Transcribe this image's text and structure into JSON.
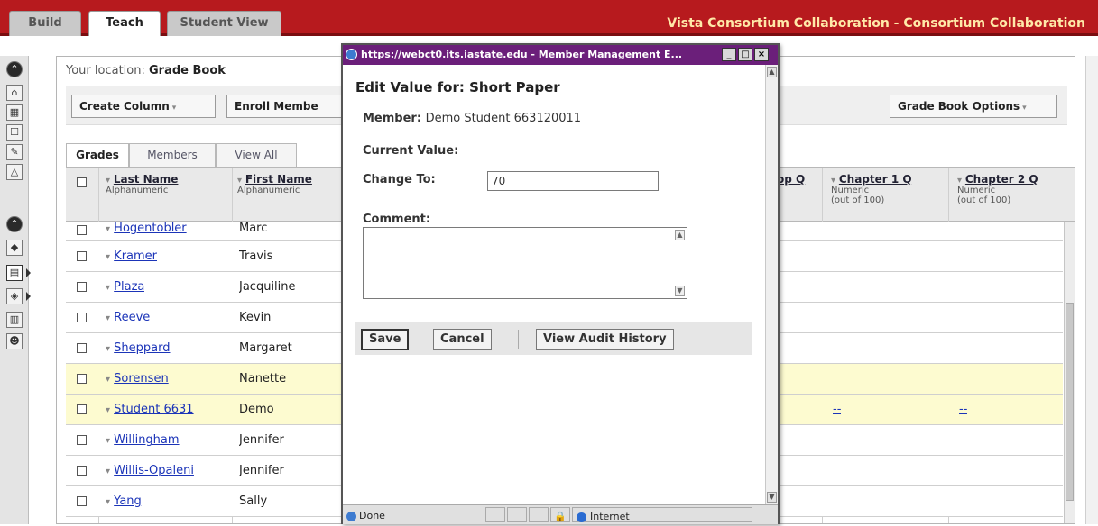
{
  "topbar": {
    "tabs": [
      {
        "label": "Build"
      },
      {
        "label": "Teach"
      },
      {
        "label": "Student View"
      }
    ],
    "org_title": "Vista Consortium Collaboration - Consortium Collaboration"
  },
  "location": {
    "prefix": "Your location:",
    "page": "Grade Book"
  },
  "toolbar": {
    "create_column": "Create Column",
    "enroll_members": "Enroll Membe",
    "grade_book_options": "Grade Book Options"
  },
  "grade_tabs": [
    "Grades",
    "Members",
    "View All"
  ],
  "columns": {
    "last_name": {
      "title": "Last Name",
      "sub": "Alphanumeric"
    },
    "first_name": {
      "title": "First Name",
      "sub": "Alphanumeric"
    },
    "col_partial": {
      "title": "op Q"
    },
    "chapter1": {
      "title": "Chapter 1 Q",
      "sub1": "Numeric",
      "sub2": "(out of 100)"
    },
    "chapter2": {
      "title": "Chapter 2 Q",
      "sub1": "Numeric",
      "sub2": "(out of 100)"
    }
  },
  "rows": [
    {
      "last": "Hogentobler",
      "first": "Marc",
      "ch1": "",
      "ch2": ""
    },
    {
      "last": "Kramer",
      "first": "Travis",
      "ch1": "",
      "ch2": ""
    },
    {
      "last": "Plaza",
      "first": "Jacquiline",
      "ch1": "",
      "ch2": ""
    },
    {
      "last": "Reeve",
      "first": "Kevin",
      "ch1": "",
      "ch2": ""
    },
    {
      "last": "Sheppard",
      "first": "Margaret",
      "ch1": "",
      "ch2": ""
    },
    {
      "last": "Sorensen",
      "first": "Nanette",
      "ch1": "",
      "ch2": ""
    },
    {
      "last": "Student 6631",
      "first": "Demo",
      "ch1": "--",
      "ch2": "--"
    },
    {
      "last": "Willingham",
      "first": "Jennifer",
      "ch1": "",
      "ch2": ""
    },
    {
      "last": "Willis-Opaleni",
      "first": "Jennifer",
      "ch1": "",
      "ch2": ""
    },
    {
      "last": "Yang",
      "first": "Sally",
      "ch1": "",
      "ch2": ""
    }
  ],
  "popup": {
    "window_title": "https://webct0.its.iastate.edu - Member Management E...",
    "heading": "Edit Value for: Short Paper",
    "member_label": "Member:",
    "member_value": "Demo Student 663120011",
    "current_value_label": "Current Value:",
    "change_to_label": "Change To:",
    "change_to_value": "70",
    "comment_label": "Comment:",
    "save": "Save",
    "cancel": "Cancel",
    "view_audit": "View Audit History",
    "status_done": "Done",
    "status_zone": "Internet"
  },
  "colors": {
    "topbar": "#b71a1e",
    "popup_title": "#6b1f7a",
    "link": "#1b34b8",
    "highlight_row": "#fdfbd0",
    "org_text": "#ffe9a8"
  }
}
